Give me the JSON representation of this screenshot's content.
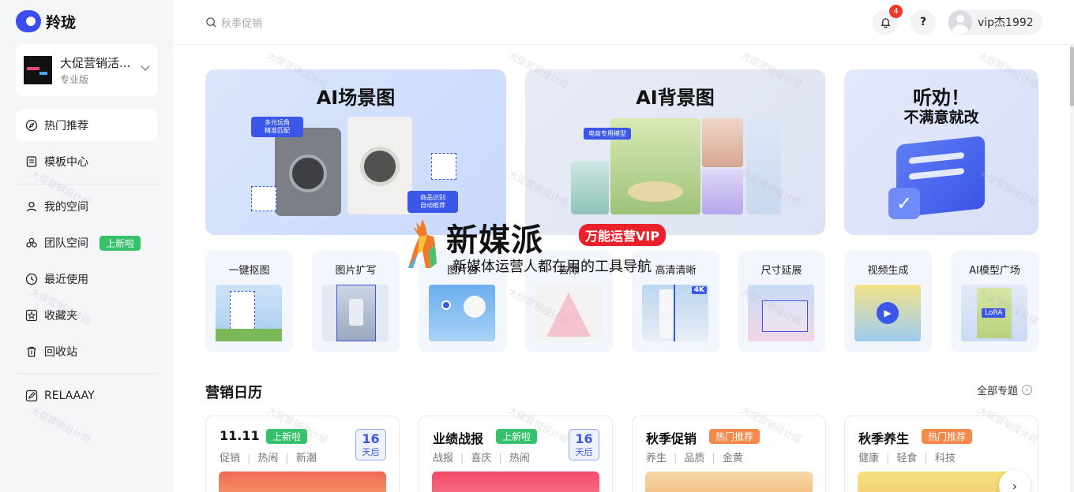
{
  "brand": {
    "name": "羚珑"
  },
  "team": {
    "name": "大促营销活...",
    "plan": "专业版"
  },
  "sidebar": {
    "items": [
      {
        "label": "热门推荐",
        "icon": "compass-icon"
      },
      {
        "label": "模板中心",
        "icon": "template-icon"
      },
      {
        "label": "我的空间",
        "icon": "user-icon"
      },
      {
        "label": "团队空间",
        "icon": "team-icon",
        "badge": "上新啦"
      },
      {
        "label": "最近使用",
        "icon": "clock-icon"
      },
      {
        "label": "收藏夹",
        "icon": "star-icon"
      },
      {
        "label": "回收站",
        "icon": "trash-icon"
      },
      {
        "label": "RELAAAY",
        "icon": "edit-icon"
      }
    ]
  },
  "header": {
    "search_placeholder": "秋季促销",
    "notification_count": "4",
    "help_label": "?",
    "username": "vip杰1992"
  },
  "banners": [
    {
      "title": "AI场景图",
      "tags": [
        "多元玩角",
        "精准匹配",
        "商品识别",
        "自动推荐"
      ]
    },
    {
      "title": "AI背景图",
      "tags": [
        "电商专用模型"
      ]
    },
    {
      "title": "听劝！",
      "subtitle": "不满意就改"
    }
  ],
  "tools": [
    {
      "label": "一键抠图"
    },
    {
      "label": "图片扩写"
    },
    {
      "label": "图片去"
    },
    {
      "label": "去除"
    },
    {
      "label": "高清清晰",
      "badge": "4K"
    },
    {
      "label": "尺寸延展"
    },
    {
      "label": "视频生成"
    },
    {
      "label": "AI模型广场",
      "badge": "LoRA"
    }
  ],
  "calendar": {
    "title": "营销日历",
    "all_label": "全部专题",
    "cards": [
      {
        "title": "11.11",
        "tag": "上新啦",
        "tag_color": "#35c26a",
        "tags": [
          "促销",
          "热闹",
          "新潮"
        ],
        "days": "16",
        "days_unit": "天后"
      },
      {
        "title": "业绩战报",
        "tag": "上新啦",
        "tag_color": "#35c26a",
        "tags": [
          "战报",
          "喜庆",
          "热闹"
        ],
        "days": "16",
        "days_unit": "天后"
      },
      {
        "title": "秋季促销",
        "tag": "热门推荐",
        "tag_color": "#f5894a",
        "tags": [
          "养生",
          "品质",
          "金黄"
        ]
      },
      {
        "title": "秋季养生",
        "tag": "热门推荐",
        "tag_color": "#f5894a",
        "tags": [
          "健康",
          "轻食",
          "科技"
        ]
      }
    ]
  },
  "watermark": {
    "title": "新媒派",
    "vip": "万能运营VIP",
    "subtitle": "新媒体运营人都在用的工具导航",
    "faint_text": "大促营销设计组"
  },
  "colors": {
    "accent": "#3b4cf0",
    "new_badge": "#35c26a",
    "hot_badge": "#f5894a",
    "notification": "#f0392a"
  }
}
